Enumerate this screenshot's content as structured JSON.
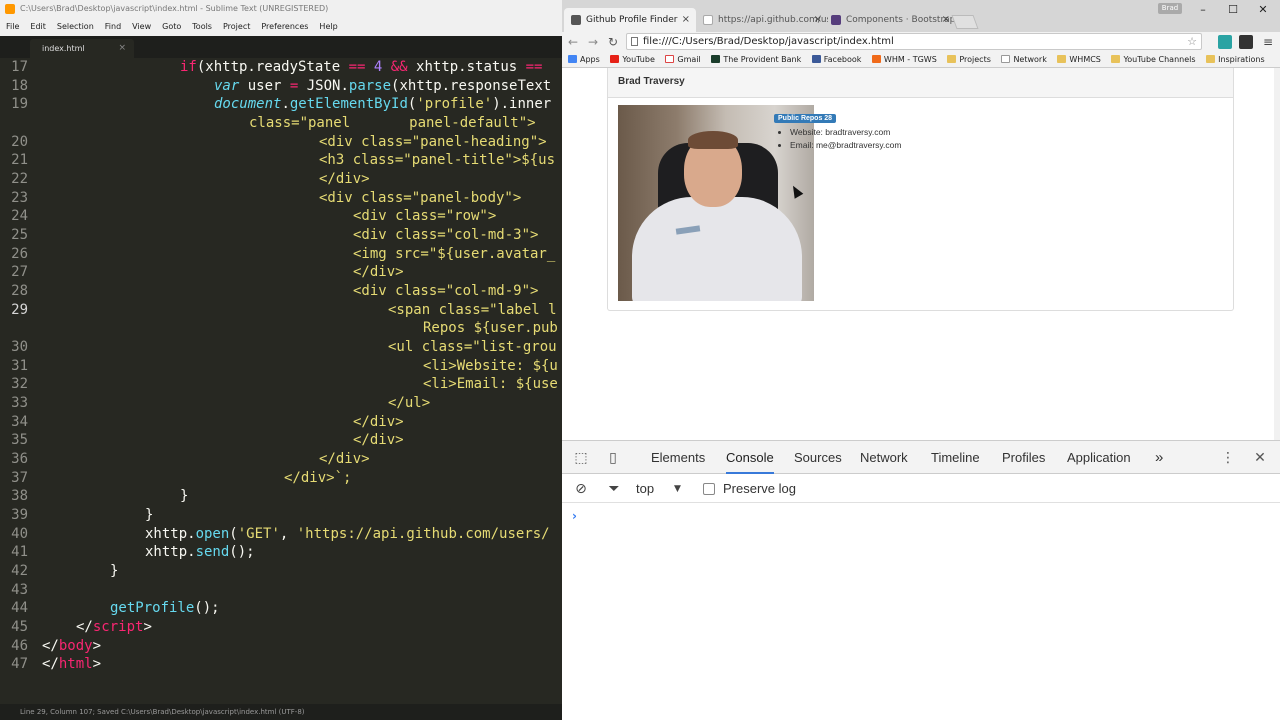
{
  "sublime": {
    "title": "C:\\Users\\Brad\\Desktop\\javascript\\index.html - Sublime Text (UNREGISTERED)",
    "menu": [
      "File",
      "Edit",
      "Selection",
      "Find",
      "View",
      "Goto",
      "Tools",
      "Project",
      "Preferences",
      "Help"
    ],
    "tab_name": "index.html",
    "tab_close": "×",
    "line_numbers": [
      "17",
      "18",
      "19",
      "",
      "20",
      "21",
      "22",
      "23",
      "24",
      "25",
      "26",
      "27",
      "28",
      "29",
      "",
      "30",
      "31",
      "32",
      "33",
      "34",
      "35",
      "36",
      "37",
      "38",
      "39",
      "40",
      "41",
      "42",
      "43",
      "44",
      "45",
      "46",
      "47"
    ],
    "status": "Line 29, Column 107; Saved C:\\Users\\Brad\\Desktop\\javascript\\index.html (UTF-8)"
  },
  "code": {
    "l17_if": "if",
    "l17_a": "(xhttp.readyState ",
    "l17_eq1": "==",
    "l17_b": " ",
    "l17_n4": "4",
    "l17_c": " ",
    "l17_and": "&&",
    "l17_d": " xhttp.status ",
    "l17_eq2": "==",
    "l18_var": "var",
    "l18_a": " user ",
    "l18_eq": "=",
    "l18_b": " JSON.",
    "l18_parse": "parse",
    "l18_c": "(xhttp.responseText",
    "l19_doc": "document",
    "l19_a": ".",
    "l19_get": "getElementById",
    "l19_b": "(",
    "l19_s": "'profile'",
    "l19_c": ").inner",
    "l19w": "class=\"panel       panel-default\">",
    "l20": "<div class=\"panel-heading\">",
    "l21": "<h3 class=\"panel-title\">${us",
    "l22": "</div>",
    "l23": "<div class=\"panel-body\">",
    "l24": "<div class=\"row\">",
    "l25": "<div class=\"col-md-3\">",
    "l26": "<img src=\"${user.avatar_",
    "l27": "</div>",
    "l28": "<div class=\"col-md-9\">",
    "l29": "<span class=\"label l",
    "l29w": "Repos ${user.pub",
    "l30": "<ul class=\"list-grou",
    "l31": "<li>Website: ${u",
    "l32": "<li>Email: ${use",
    "l33": "</ul>",
    "l34": "</div>",
    "l35": "</div>",
    "l36": "</div>",
    "l37": "</div>`;",
    "l38": "}",
    "l39": "}",
    "l40_a": "xhttp.",
    "l40_open": "open",
    "l40_b": "(",
    "l40_s1": "'GET'",
    "l40_c": ", ",
    "l40_s2": "'https://api.github.com/users/",
    "l41_a": "xhttp.",
    "l41_send": "send",
    "l41_b": "();",
    "l42": "}",
    "l44_get": "getProfile",
    "l44_b": "();",
    "l45_a": "</",
    "l45_t": "script",
    "l45_b": ">",
    "l46_a": "</",
    "l46_t": "body",
    "l46_b": ">",
    "l47_a": "</",
    "l47_t": "html",
    "l47_b": ">"
  },
  "chrome": {
    "user": "Brad",
    "tabs": [
      {
        "title": "Github Profile Finder",
        "close": "×"
      },
      {
        "title": "https://api.github.com/us",
        "close": "×"
      },
      {
        "title": "Components · Bootstrap",
        "close": "×"
      }
    ],
    "url": "file:///C:/Users/Brad/Desktop/javascript/index.html",
    "bookmarks": [
      "Apps",
      "YouTube",
      "Gmail",
      "The Provident Bank",
      "Facebook",
      "WHM - TGWS",
      "Projects",
      "Network",
      "WHMCS",
      "YouTube Channels",
      "Inspirations"
    ],
    "colors": {
      "accent": "#3879d9",
      "badge": "#337ab7",
      "editor_bg": "#272822"
    }
  },
  "profile": {
    "name": "Brad Traversy",
    "badge": "Public Repos 28",
    "website": "Website: bradtraversy.com",
    "email": "Email: me@bradtraversy.com"
  },
  "devtools": {
    "tabs": [
      "Elements",
      "Console",
      "Sources",
      "Network",
      "Timeline",
      "Profiles",
      "Application"
    ],
    "more": "»",
    "context": "top",
    "preserve_log": "Preserve log",
    "prompt": "›"
  }
}
